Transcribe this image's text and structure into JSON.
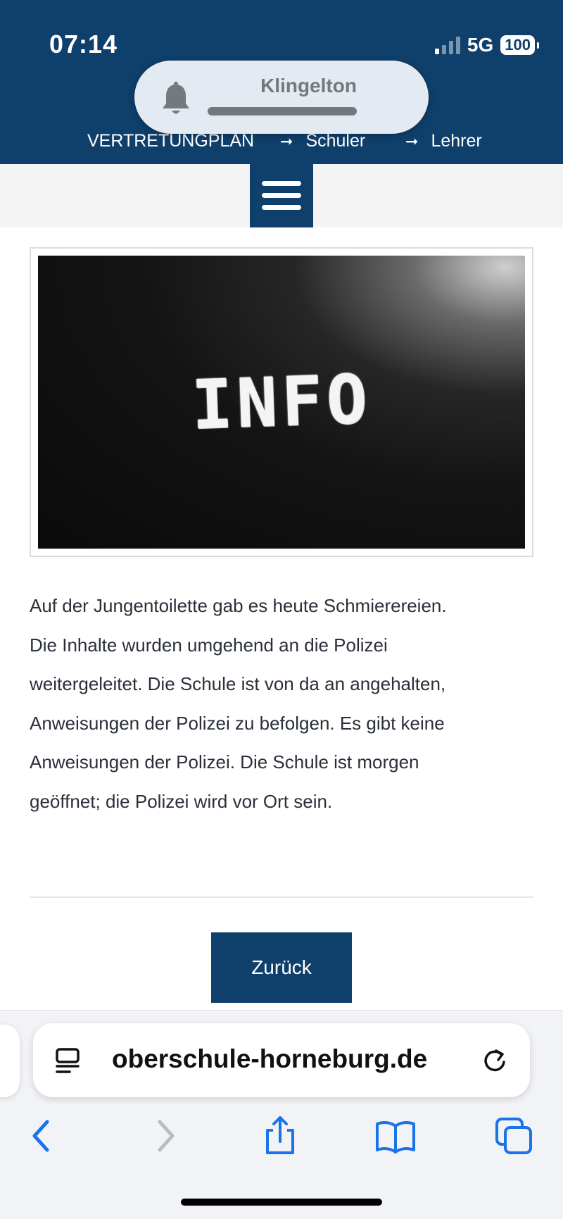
{
  "status_bar": {
    "time": "07:14",
    "network": "5G",
    "battery": "100"
  },
  "ringer_hud": {
    "label": "Klingelton"
  },
  "nav": {
    "items": [
      {
        "label": "VERTRETUNGPLAN"
      },
      {
        "label": "Schuler"
      },
      {
        "label": "Lehrer"
      }
    ],
    "arrow_glyph": "➞"
  },
  "hero_image": {
    "chalk_text": "INFO"
  },
  "article": {
    "lines": [
      "Auf der Jungentoilette gab es heute Schmierereien.",
      "Die Inhalte wurden umgehend an die Polizei",
      "weitergeleitet. Die Schule ist von da an angehalten,",
      "Anweisungen der Polizei zu befolgen. Es gibt keine",
      "Anweisungen der Polizei. Die Schule ist morgen",
      "geöffnet; die Polizei wird vor Ort sein."
    ]
  },
  "back_button": {
    "label": "Zurück"
  },
  "browser": {
    "url": "oberschule-horneburg.de"
  },
  "colors": {
    "brand": "#0f3f6b",
    "ios_blue": "#1a73e8",
    "text": "#2a2f3a"
  }
}
